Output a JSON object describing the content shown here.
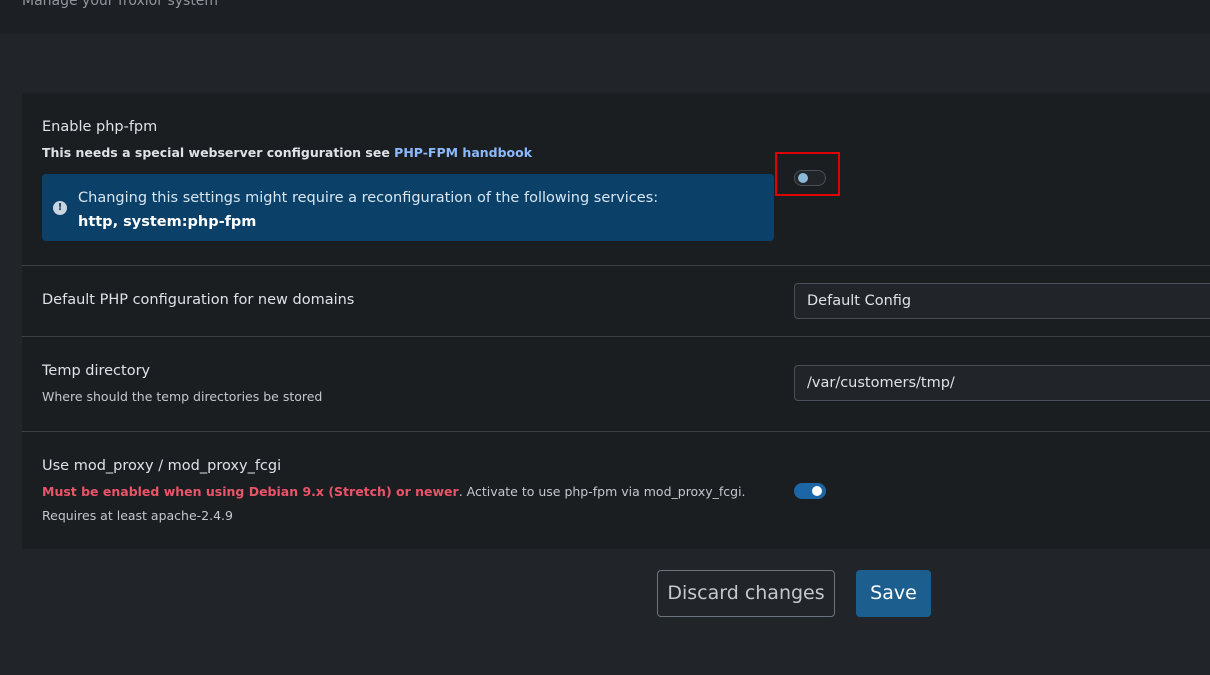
{
  "header": {
    "subtitle": "Manage your froxlor system"
  },
  "settings": {
    "php_fpm": {
      "label": "Enable php-fpm",
      "description_prefix": "This needs a special webserver configuration see ",
      "description_link": "PHP-FPM handbook",
      "alert_text": "Changing this settings might require a reconfiguration of the following services:",
      "alert_services": "http, system:php-fpm",
      "alert_icon": "exclamation-circle-icon",
      "enabled": false
    },
    "default_php_config": {
      "label": "Default PHP configuration for new domains",
      "selected": "Default Config"
    },
    "temp_dir": {
      "label": "Temp directory",
      "description": "Where should the temp directories be stored",
      "value": "/var/customers/tmp/"
    },
    "mod_proxy": {
      "label": "Use mod_proxy / mod_proxy_fcgi",
      "description_warning": "Must be enabled when using Debian 9.x (Stretch) or newer",
      "description_rest": ". Activate to use php-fpm via mod_proxy_fcgi. Requires at least apache-2.4.9",
      "enabled": true
    }
  },
  "actions": {
    "discard_label": "Discard changes",
    "save_label": "Save"
  },
  "colors": {
    "accent": "#1c5f8f",
    "alert_bg": "#0b4068",
    "warning": "#ea5469",
    "highlight": "#e00000"
  }
}
